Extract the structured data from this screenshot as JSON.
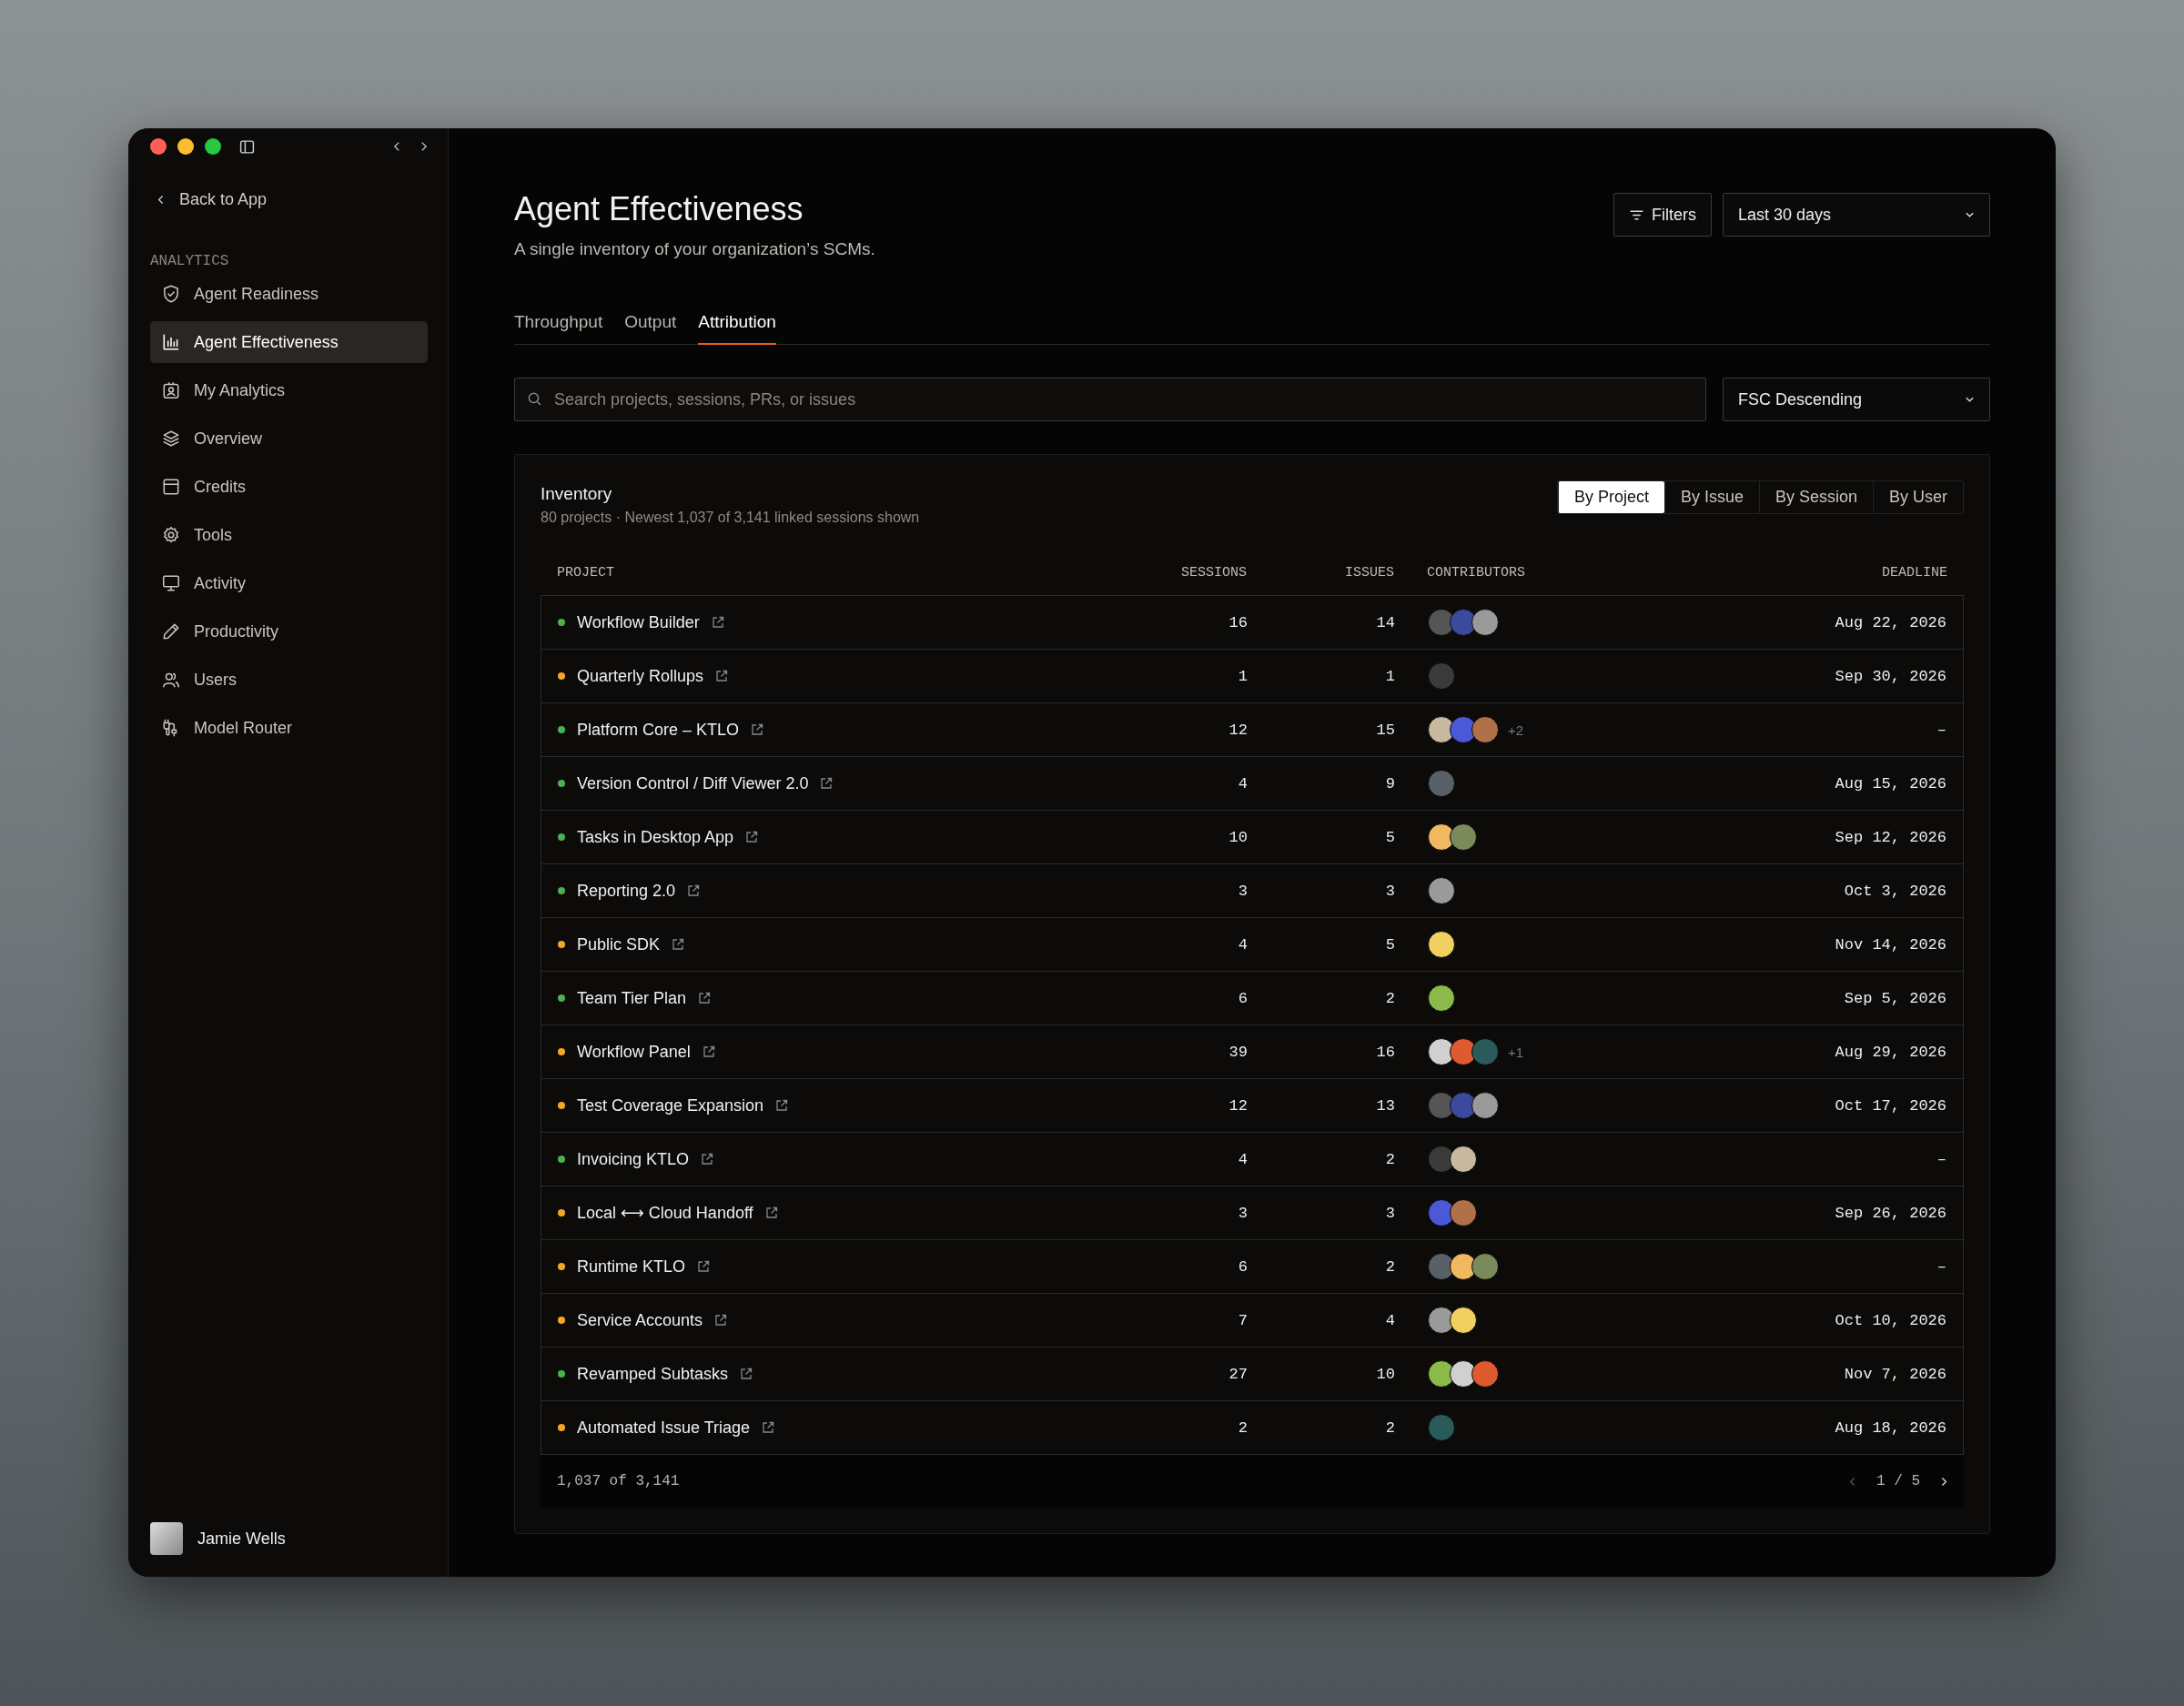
{
  "window": {
    "controls": [
      {
        "color": "#ff5f57"
      },
      {
        "color": "#febc2e"
      },
      {
        "color": "#28c840"
      }
    ]
  },
  "sidebar": {
    "back": "Back to App",
    "section": "ANALYTICS",
    "items": [
      {
        "label": "Agent Readiness",
        "kind": "shield",
        "selected": false
      },
      {
        "label": "Agent Effectiveness",
        "kind": "chart",
        "selected": true
      },
      {
        "label": "My Analytics",
        "kind": "badge",
        "selected": false
      },
      {
        "label": "Overview",
        "kind": "layers",
        "selected": false
      },
      {
        "label": "Credits",
        "kind": "card",
        "selected": false
      },
      {
        "label": "Tools",
        "kind": "gear",
        "selected": false
      },
      {
        "label": "Activity",
        "kind": "monitor",
        "selected": false
      },
      {
        "label": "Productivity",
        "kind": "pencil",
        "selected": false
      },
      {
        "label": "Users",
        "kind": "users",
        "selected": false
      },
      {
        "label": "Model Router",
        "kind": "plug",
        "selected": false
      }
    ],
    "user": {
      "name": "Jamie Wells"
    }
  },
  "header": {
    "title": "Agent Effectiveness",
    "subtitle": "A single inventory of your organization’s SCMs.",
    "filters_button": "Filters",
    "range": "Last 30 days"
  },
  "tabs": [
    {
      "label": "Throughput",
      "selected": false
    },
    {
      "label": "Output",
      "selected": false
    },
    {
      "label": "Attribution",
      "selected": true
    }
  ],
  "search": {
    "placeholder": "Search projects, sessions, PRs, or issues"
  },
  "sort": "FSC Descending",
  "inventory": {
    "title": "Inventory",
    "subtitle": "80 projects · Newest 1,037 of 3,141 linked sessions shown",
    "views": [
      {
        "label": "By Project",
        "selected": true
      },
      {
        "label": "By Issue",
        "selected": false
      },
      {
        "label": "By Session",
        "selected": false
      },
      {
        "label": "By User",
        "selected": false
      }
    ],
    "columns": [
      "PROJECT",
      "SESSIONS",
      "ISSUES",
      "CONTRIBUTORS",
      "DEADLINE"
    ],
    "rows": [
      {
        "project": "Workflow Builder",
        "color": "#4caf50",
        "sessions": "16",
        "issues": "14",
        "contributors": [
          {
            "color": "#555555"
          },
          {
            "color": "#3b4a9c"
          },
          {
            "color": "#9a9a9a"
          }
        ],
        "deadline": "Aug 22, 2026"
      },
      {
        "project": "Quarterly Rollups",
        "color": "#f5a623",
        "sessions": "1",
        "issues": "1",
        "contributors": [
          {
            "color": "#3a3a3a"
          }
        ],
        "deadline": "Sep 30, 2026"
      },
      {
        "project": "Platform Core – KTLO",
        "color": "#4caf50",
        "sessions": "12",
        "issues": "15",
        "contributors": [
          {
            "color": "#c8b8a0"
          },
          {
            "color": "#4b58d8"
          },
          {
            "color": "#b0704a"
          }
        ],
        "more": "+2",
        "deadline": "–"
      },
      {
        "project": "Version Control / Diff Viewer 2.0",
        "color": "#4caf50",
        "sessions": "4",
        "issues": "9",
        "contributors": [
          {
            "color": "#5a6068"
          }
        ],
        "deadline": "Aug 15, 2026"
      },
      {
        "project": "Tasks in Desktop App",
        "color": "#4caf50",
        "sessions": "10",
        "issues": "5",
        "contributors": [
          {
            "color": "#f0b860"
          },
          {
            "color": "#7a8a5a"
          }
        ],
        "deadline": "Sep 12, 2026"
      },
      {
        "project": "Reporting 2.0",
        "color": "#4caf50",
        "sessions": "3",
        "issues": "3",
        "contributors": [
          {
            "color": "#9a9a9a"
          }
        ],
        "deadline": "Oct 3, 2026"
      },
      {
        "project": "Public SDK",
        "color": "#f5a623",
        "sessions": "4",
        "issues": "5",
        "contributors": [
          {
            "color": "#f0d060"
          }
        ],
        "deadline": "Nov 14, 2026"
      },
      {
        "project": "Team Tier Plan",
        "color": "#4caf50",
        "sessions": "6",
        "issues": "2",
        "contributors": [
          {
            "color": "#8aba4a"
          }
        ],
        "deadline": "Sep 5, 2026"
      },
      {
        "project": "Workflow Panel",
        "color": "#f5a623",
        "sessions": "39",
        "issues": "16",
        "contributors": [
          {
            "color": "#d0d0d0"
          },
          {
            "color": "#e05a30"
          },
          {
            "color": "#2a5a5a"
          }
        ],
        "more": "+1",
        "deadline": "Aug 29, 2026"
      },
      {
        "project": "Test Coverage Expansion",
        "color": "#f5a623",
        "sessions": "12",
        "issues": "13",
        "contributors": [
          {
            "color": "#555555"
          },
          {
            "color": "#3b4a9c"
          },
          {
            "color": "#9a9a9a"
          }
        ],
        "deadline": "Oct 17, 2026"
      },
      {
        "project": "Invoicing KTLO",
        "color": "#4caf50",
        "sessions": "4",
        "issues": "2",
        "contributors": [
          {
            "color": "#3a3a3a"
          },
          {
            "color": "#c8b8a0"
          }
        ],
        "deadline": "–"
      },
      {
        "project": "Local ⟷ Cloud Handoff",
        "color": "#f5a623",
        "sessions": "3",
        "issues": "3",
        "contributors": [
          {
            "color": "#4b58d8"
          },
          {
            "color": "#b0704a"
          }
        ],
        "deadline": "Sep 26, 2026"
      },
      {
        "project": "Runtime KTLO",
        "color": "#f5a623",
        "sessions": "6",
        "issues": "2",
        "contributors": [
          {
            "color": "#5a6068"
          },
          {
            "color": "#f0b860"
          },
          {
            "color": "#7a8a5a"
          }
        ],
        "deadline": "–"
      },
      {
        "project": "Service Accounts",
        "color": "#f5a623",
        "sessions": "7",
        "issues": "4",
        "contributors": [
          {
            "color": "#9a9a9a"
          },
          {
            "color": "#f0d060"
          }
        ],
        "deadline": "Oct 10, 2026"
      },
      {
        "project": "Revamped Subtasks",
        "color": "#4caf50",
        "sessions": "27",
        "issues": "10",
        "contributors": [
          {
            "color": "#8aba4a"
          },
          {
            "color": "#d0d0d0"
          },
          {
            "color": "#e05a30"
          }
        ],
        "deadline": "Nov 7, 2026"
      },
      {
        "project": "Automated Issue Triage",
        "color": "#f5a623",
        "sessions": "2",
        "issues": "2",
        "contributors": [
          {
            "color": "#2a5a5a"
          }
        ],
        "deadline": "Aug 18, 2026"
      }
    ],
    "footer": {
      "count": "1,037 of 3,141",
      "page": "1 / 5"
    }
  }
}
